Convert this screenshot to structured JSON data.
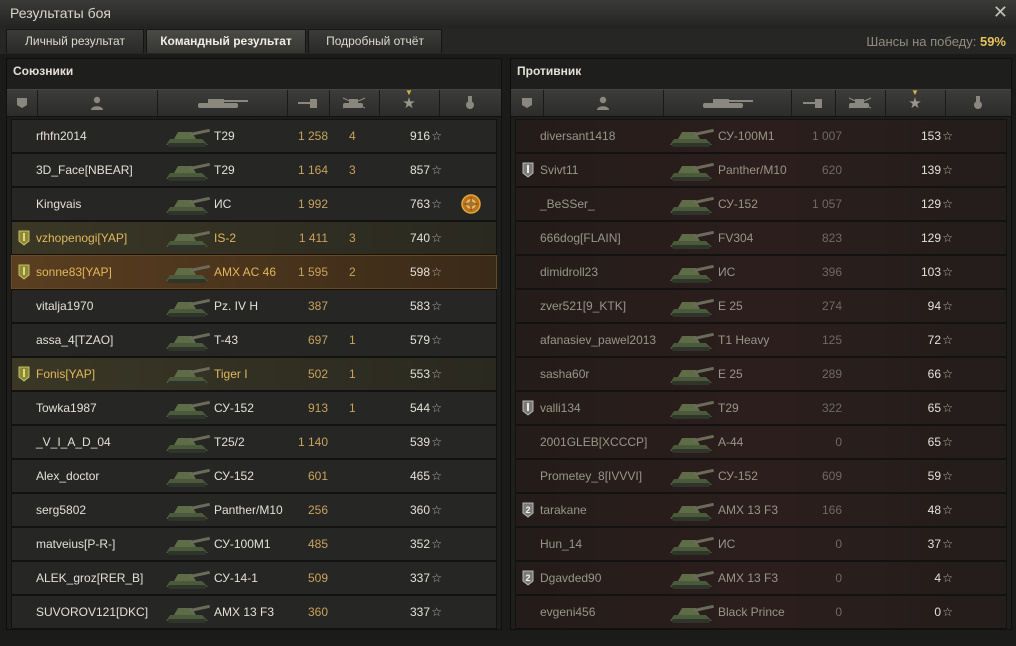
{
  "window": {
    "title": "Результаты боя"
  },
  "tabs": [
    "Личный результат",
    "Командный результат",
    "Подробный отчёт"
  ],
  "chance": {
    "label": "Шансы на победу:",
    "value": "59%"
  },
  "allies": {
    "title": "Союзники",
    "rows": [
      {
        "name": "rfhfn2014",
        "tank": "T29",
        "dmg": "1 258",
        "kills": "4",
        "xp": "916"
      },
      {
        "name": "3D_Face[NBEAR]",
        "tank": "T29",
        "dmg": "1 164",
        "kills": "3",
        "xp": "857"
      },
      {
        "name": "Kingvais",
        "tank": "ИС",
        "dmg": "1 992",
        "kills": "",
        "xp": "763"
      },
      {
        "name": "vzhopenogi[YAP]",
        "tank": "IS-2",
        "dmg": "1 411",
        "kills": "3",
        "xp": "740"
      },
      {
        "name": "sonne83[YAP]",
        "tank": "AMX AC 46",
        "dmg": "1 595",
        "kills": "2",
        "xp": "598"
      },
      {
        "name": "vitalja1970",
        "tank": "Pz. IV H",
        "dmg": "387",
        "kills": "",
        "xp": "583"
      },
      {
        "name": "assa_4[TZAO]",
        "tank": "T-43",
        "dmg": "697",
        "kills": "1",
        "xp": "579"
      },
      {
        "name": "Fonis[YAP]",
        "tank": "Tiger I",
        "dmg": "502",
        "kills": "1",
        "xp": "553"
      },
      {
        "name": "Towka1987",
        "tank": "СУ-152",
        "dmg": "913",
        "kills": "1",
        "xp": "544"
      },
      {
        "name": "_V_I_A_D_04",
        "tank": "T25/2",
        "dmg": "1 140",
        "kills": "",
        "xp": "539"
      },
      {
        "name": "Alex_doctor",
        "tank": "СУ-152",
        "dmg": "601",
        "kills": "",
        "xp": "465"
      },
      {
        "name": "serg5802",
        "tank": "Panther/M10",
        "dmg": "256",
        "kills": "",
        "xp": "360"
      },
      {
        "name": "matveius[P-R-]",
        "tank": "СУ-100М1",
        "dmg": "485",
        "kills": "",
        "xp": "352"
      },
      {
        "name": "ALEK_groz[RER_B]",
        "tank": "СУ-14-1",
        "dmg": "509",
        "kills": "",
        "xp": "337"
      },
      {
        "name": "SUVOROV121[DKC]",
        "tank": "AMX 13 F3",
        "dmg": "360",
        "kills": "",
        "xp": "337"
      }
    ]
  },
  "enemies": {
    "title": "Противник",
    "rows": [
      {
        "name": "diversant1418",
        "tank": "СУ-100М1",
        "dmg": "1 007",
        "xp": "153"
      },
      {
        "name": "Svivt11",
        "tank": "Panther/M10",
        "dmg": "620",
        "xp": "139"
      },
      {
        "name": "_BeSSer_",
        "tank": "СУ-152",
        "dmg": "1 057",
        "xp": "129"
      },
      {
        "name": "666dog[FLAIN]",
        "tank": "FV304",
        "dmg": "823",
        "xp": "129"
      },
      {
        "name": "dimidroll23",
        "tank": "ИС",
        "dmg": "396",
        "xp": "103"
      },
      {
        "name": "zver521[9_KTK]",
        "tank": "E 25",
        "dmg": "274",
        "xp": "94"
      },
      {
        "name": "afanasiev_pawel2013",
        "tank": "T1 Heavy",
        "dmg": "125",
        "xp": "72"
      },
      {
        "name": "sasha60r",
        "tank": "E 25",
        "dmg": "289",
        "xp": "66"
      },
      {
        "name": "valli134",
        "tank": "T29",
        "dmg": "322",
        "xp": "65"
      },
      {
        "name": "2001GLEB[XCCCP]",
        "tank": "A-44",
        "dmg": "0",
        "xp": "65"
      },
      {
        "name": "Prometey_8[IVVVI]",
        "tank": "СУ-152",
        "dmg": "609",
        "xp": "59"
      },
      {
        "name": "tarakane",
        "tank": "AMX 13 F3",
        "dmg": "166",
        "xp": "48"
      },
      {
        "name": "Hun_14",
        "tank": "ИС",
        "dmg": "0",
        "xp": "37"
      },
      {
        "name": "Dgavded90",
        "tank": "AMX 13 F3",
        "dmg": "0",
        "xp": "4"
      },
      {
        "name": "evgeni456",
        "tank": "Black Prince",
        "dmg": "0",
        "xp": "0"
      }
    ]
  }
}
